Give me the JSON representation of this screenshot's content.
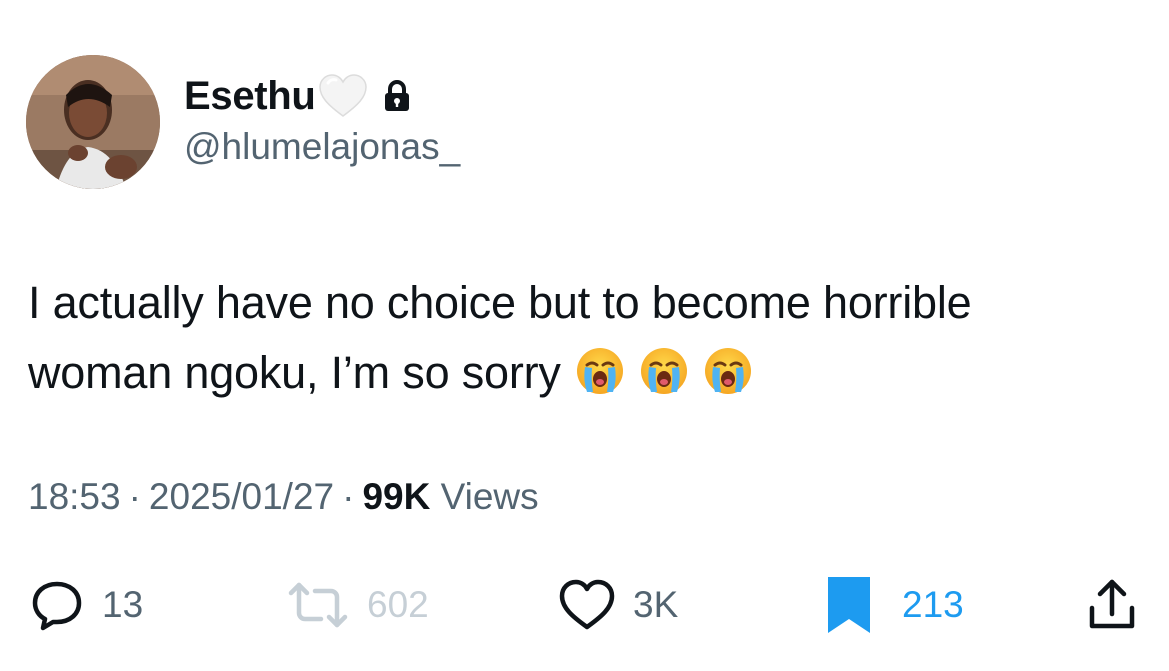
{
  "author": {
    "display_name": "Esethu",
    "name_emoji": "white-heart-icon",
    "protected_icon": "lock-icon",
    "handle": "@hlumelajonas_"
  },
  "tweet": {
    "line1": "I actually have no choice but to become horrible",
    "line2": "woman ngoku, I’m so sorry",
    "emojis": [
      "loudly-crying-face-icon",
      "loudly-crying-face-icon",
      "loudly-crying-face-icon"
    ]
  },
  "meta": {
    "time": "18:53",
    "separator": "·",
    "date": "2025/01/27",
    "views_count": "99K",
    "views_label": "Views"
  },
  "actions": {
    "replies": "13",
    "retweets": "602",
    "likes": "3K",
    "bookmarks": "213"
  },
  "colors": {
    "text_primary": "#0f1419",
    "text_secondary": "#536471",
    "retweet_muted": "#c6cfd6",
    "bookmark_active": "#1d9bf0"
  }
}
